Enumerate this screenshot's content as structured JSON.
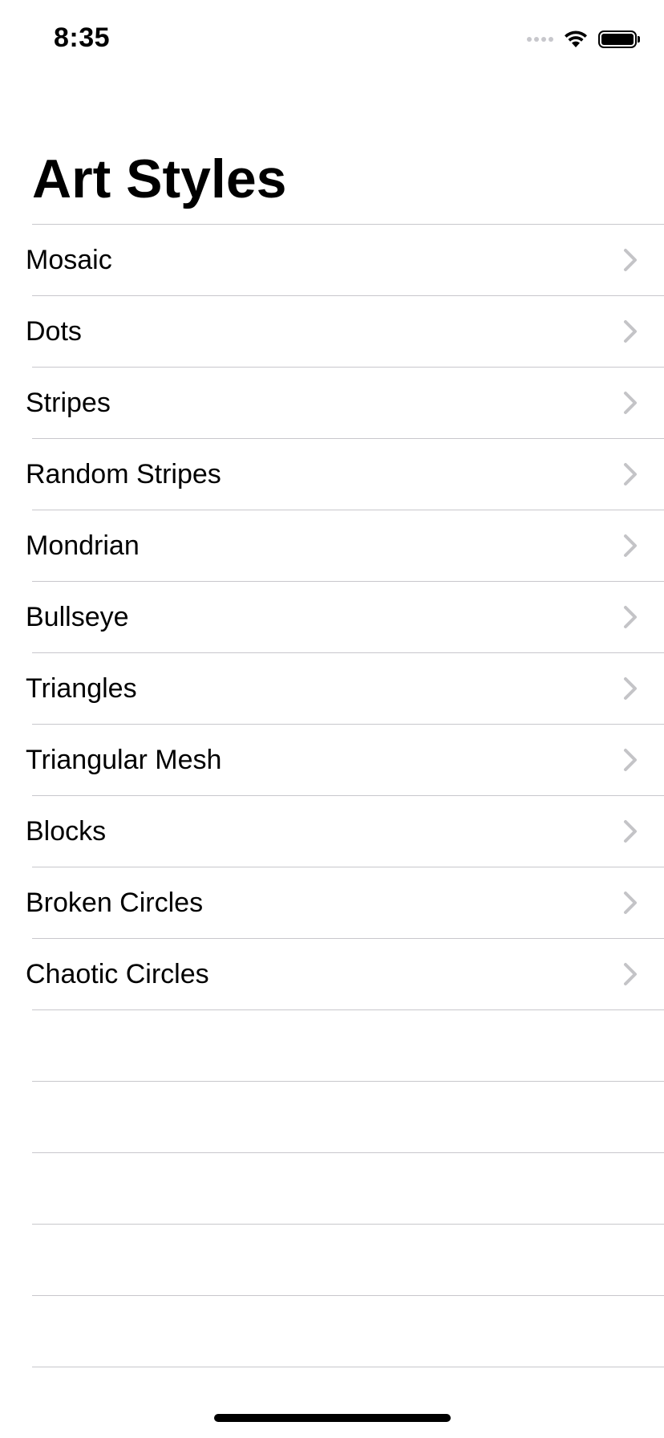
{
  "status_bar": {
    "time": "8:35",
    "signal_icon": "cellular-signal-icon",
    "wifi_icon": "wifi-icon",
    "battery_icon": "battery-icon",
    "battery_level": 1.0
  },
  "nav": {
    "title": "Art Styles"
  },
  "list": {
    "chevron_icon": "chevron-right-icon",
    "chevron_color": "#c4c4c7",
    "items": [
      {
        "label": "Mosaic"
      },
      {
        "label": "Dots"
      },
      {
        "label": "Stripes"
      },
      {
        "label": "Random Stripes"
      },
      {
        "label": "Mondrian"
      },
      {
        "label": "Bullseye"
      },
      {
        "label": "Triangles"
      },
      {
        "label": "Triangular Mesh"
      },
      {
        "label": "Blocks"
      },
      {
        "label": "Broken Circles"
      },
      {
        "label": "Chaotic Circles"
      }
    ]
  },
  "colors": {
    "separator": "#c8c7cc",
    "text": "#000000",
    "background": "#ffffff"
  }
}
